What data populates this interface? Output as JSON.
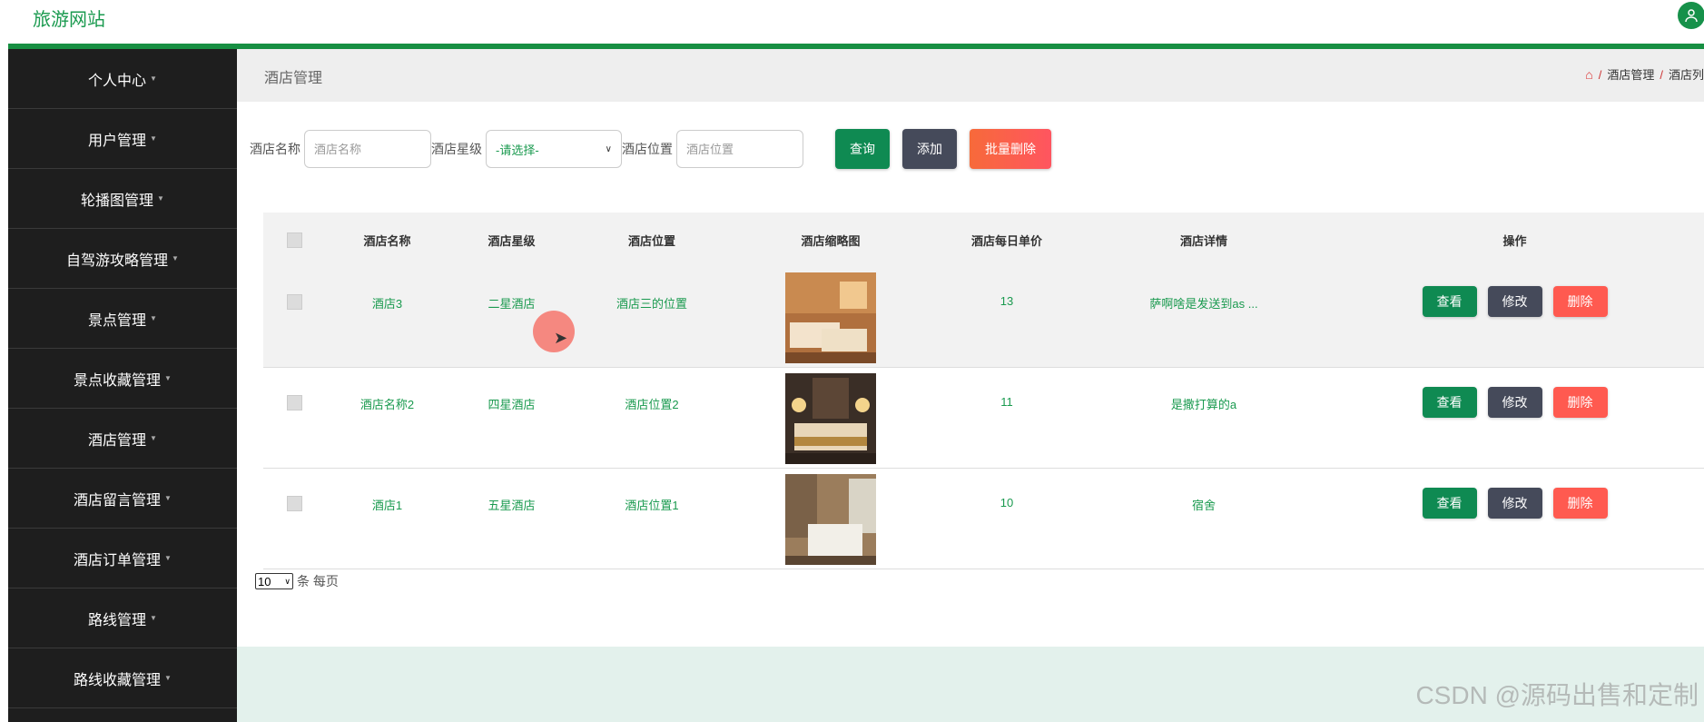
{
  "app": {
    "brand": "旅游网站",
    "user_icon": "user-icon"
  },
  "sidebar": {
    "items": [
      {
        "label": "个人中心"
      },
      {
        "label": "用户管理"
      },
      {
        "label": "轮播图管理"
      },
      {
        "label": "自驾游攻略管理"
      },
      {
        "label": "景点管理"
      },
      {
        "label": "景点收藏管理"
      },
      {
        "label": "酒店管理"
      },
      {
        "label": "酒店留言管理"
      },
      {
        "label": "酒店订单管理"
      },
      {
        "label": "路线管理"
      },
      {
        "label": "路线收藏管理"
      }
    ]
  },
  "header": {
    "title": "酒店管理",
    "breadcrumb": [
      "酒店管理",
      "酒店列"
    ]
  },
  "search": {
    "name_label": "酒店名称",
    "name_placeholder": "酒店名称",
    "star_label": "酒店星级",
    "star_selected": "-请选择-",
    "location_label": "酒店位置",
    "location_placeholder": "酒店位置",
    "query_label": "查询",
    "add_label": "添加",
    "batch_delete_label": "批量删除"
  },
  "table": {
    "headers": [
      "酒店名称",
      "酒店星级",
      "酒店位置",
      "酒店缩略图",
      "酒店每日单价",
      "酒店详情",
      "操作"
    ],
    "rows": [
      {
        "name": "酒店3",
        "star": "二星酒店",
        "location": "酒店三的位置",
        "price": "13",
        "detail": "萨啊啥是发送到as ..."
      },
      {
        "name": "酒店名称2",
        "star": "四星酒店",
        "location": "酒店位置2",
        "price": "11",
        "detail": "是撒打算的a"
      },
      {
        "name": "酒店1",
        "star": "五星酒店",
        "location": "酒店位置1",
        "price": "10",
        "detail": "宿舍"
      }
    ],
    "actions": {
      "view": "查看",
      "edit": "修改",
      "delete": "删除"
    }
  },
  "pager": {
    "page_size": "10",
    "per_page_label": "条 每页"
  },
  "watermark": "CSDN @源码出售和定制",
  "colors": {
    "accent": "#178f42",
    "sidebar": "#1e1e1e",
    "danger": "#ff5a50"
  }
}
